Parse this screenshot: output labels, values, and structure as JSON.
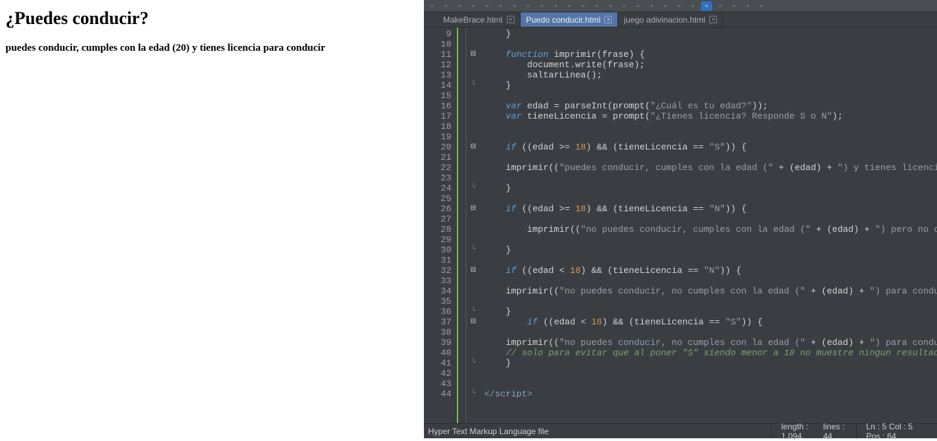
{
  "browser": {
    "heading": "¿Puedes conducir?",
    "paragraph": "puedes conducir, cumples con la edad (20) y tienes licencia para conducir"
  },
  "tabs": [
    {
      "label": "MakeBrace.html",
      "active": false
    },
    {
      "label": "Puedo conducir.html",
      "active": true
    },
    {
      "label": "juego adivinacion.html",
      "active": false
    }
  ],
  "code_lines": [
    {
      "n": 9,
      "fold": "",
      "html": "    <span class='op'>}</span>"
    },
    {
      "n": 10,
      "fold": "",
      "html": ""
    },
    {
      "n": 11,
      "fold": "box",
      "html": "    <span class='kw'>function</span> <span class='fn'>imprimir</span><span class='paren'>(</span>frase<span class='paren'>)</span> <span class='op'>{</span>"
    },
    {
      "n": 12,
      "fold": "",
      "html": "        document<span class='op'>.</span>write<span class='paren'>(</span>frase<span class='paren'>)</span><span class='op'>;</span>"
    },
    {
      "n": 13,
      "fold": "",
      "html": "        saltarLinea<span class='paren'>()</span><span class='op'>;</span>"
    },
    {
      "n": 14,
      "fold": "end",
      "html": "    <span class='op'>}</span>"
    },
    {
      "n": 15,
      "fold": "",
      "html": ""
    },
    {
      "n": 16,
      "fold": "",
      "html": "    <span class='kw'>var</span> edad <span class='op'>=</span> parseInt<span class='paren'>(</span>prompt<span class='paren'>(</span><span class='str'>\"¿Cuál es tu edad?\"</span><span class='paren'>))</span><span class='op'>;</span>"
    },
    {
      "n": 17,
      "fold": "",
      "html": "    <span class='kw'>var</span> tieneLicencia <span class='op'>=</span> prompt<span class='paren'>(</span><span class='str'>\"¿Tienes licencia? Responde S o N\"</span><span class='paren'>)</span><span class='op'>;</span>"
    },
    {
      "n": 18,
      "fold": "",
      "html": ""
    },
    {
      "n": 19,
      "fold": "",
      "html": ""
    },
    {
      "n": 20,
      "fold": "box",
      "html": "    <span class='kw'>if</span> <span class='paren'>((</span>edad <span class='op'>&gt;=</span> <span class='num'>18</span><span class='paren'>)</span> <span class='op'>&amp;&amp;</span> <span class='paren'>(</span>tieneLicencia <span class='op'>==</span> <span class='str'>\"S\"</span><span class='paren'>))</span> <span class='op'>{</span>"
    },
    {
      "n": 21,
      "fold": "",
      "html": ""
    },
    {
      "n": 22,
      "fold": "",
      "html": "    imprimir<span class='paren'>((</span><span class='str'>\"puedes conducir, cumples con la edad (\"</span> <span class='op'>+</span> <span class='paren'>(</span>edad<span class='paren'>)</span> <span class='op'>+</span> <span class='str'>\") y tienes licencia para cond</span>"
    },
    {
      "n": 23,
      "fold": "",
      "html": ""
    },
    {
      "n": 24,
      "fold": "end",
      "html": "    <span class='op'>}</span>"
    },
    {
      "n": 25,
      "fold": "",
      "html": ""
    },
    {
      "n": 26,
      "fold": "box",
      "html": "    <span class='kw'>if</span> <span class='paren'>((</span>edad <span class='op'>&gt;=</span> <span class='num'>18</span><span class='paren'>)</span> <span class='op'>&amp;&amp;</span> <span class='paren'>(</span>tieneLicencia <span class='op'>==</span> <span class='str'>\"N\"</span><span class='paren'>))</span> <span class='op'>{</span>"
    },
    {
      "n": 27,
      "fold": "",
      "html": ""
    },
    {
      "n": 28,
      "fold": "",
      "html": "        imprimir<span class='paren'>((</span><span class='str'>\"no puedes conducir, cumples con la edad (\"</span> <span class='op'>+</span> <span class='paren'>(</span>edad<span class='paren'>)</span> <span class='op'>+</span> <span class='str'>\") pero no cuentas con l</span>"
    },
    {
      "n": 29,
      "fold": "",
      "html": ""
    },
    {
      "n": 30,
      "fold": "end",
      "html": "    <span class='op'>}</span>"
    },
    {
      "n": 31,
      "fold": "",
      "html": ""
    },
    {
      "n": 32,
      "fold": "box",
      "html": "    <span class='kw'>if</span> <span class='paren'>((</span>edad <span class='op'>&lt;</span> <span class='num'>18</span><span class='paren'>)</span> <span class='op'>&amp;&amp;</span> <span class='paren'>(</span>tieneLicencia <span class='op'>==</span> <span class='str'>\"N\"</span><span class='paren'>))</span> <span class='op'>{</span>"
    },
    {
      "n": 33,
      "fold": "",
      "html": ""
    },
    {
      "n": 34,
      "fold": "",
      "html": "    imprimir<span class='paren'>((</span><span class='str'>\"no puedes conducir, no cumples con la edad (\"</span> <span class='op'>+</span> <span class='paren'>(</span>edad<span class='paren'>)</span> <span class='op'>+</span> <span class='str'>\") para conducir\"</span><span class='paren'>))</span>"
    },
    {
      "n": 35,
      "fold": "",
      "html": ""
    },
    {
      "n": 36,
      "fold": "end",
      "html": "    <span class='op'>}</span>"
    },
    {
      "n": 37,
      "fold": "box",
      "html": "        <span class='kw'>if</span> <span class='paren'>((</span>edad <span class='op'>&lt;</span> <span class='num'>18</span><span class='paren'>)</span> <span class='op'>&amp;&amp;</span> <span class='paren'>(</span>tieneLicencia <span class='op'>==</span> <span class='str'>\"S\"</span><span class='paren'>))</span> <span class='op'>{</span>"
    },
    {
      "n": 38,
      "fold": "",
      "html": ""
    },
    {
      "n": 39,
      "fold": "",
      "html": "    imprimir<span class='paren'>((</span><span class='str'>\"no puedes conducir, no cumples con la edad (\"</span> <span class='op'>+</span> <span class='paren'>(</span>edad<span class='paren'>)</span> <span class='op'>+</span> <span class='str'>\") para conducir\"</span><span class='paren'>))</span>"
    },
    {
      "n": 40,
      "fold": "",
      "html": "    <span class='cmt'>// solo para evitar que al poner \"S\" siendo menor a 18 no muestre ningun resultado</span>"
    },
    {
      "n": 41,
      "fold": "end",
      "html": "    <span class='op'>}</span>"
    },
    {
      "n": 42,
      "fold": "",
      "html": ""
    },
    {
      "n": 43,
      "fold": "",
      "html": ""
    },
    {
      "n": 44,
      "fold": "end",
      "html": "<span class='tag'>&lt;/script&gt;</span>"
    }
  ],
  "statusbar": {
    "filetype": "Hyper Text Markup Language file",
    "length_label": "length : 1,094",
    "lines_label": "lines : 44",
    "pos_label": "Ln : 5   Col : 5   Pos : 64"
  },
  "toolbar_icons": [
    "new",
    "open",
    "save",
    "save-all",
    "close",
    "print",
    "cut",
    "copy",
    "paste",
    "undo",
    "redo",
    "find",
    "replace",
    "zoom-in",
    "zoom-out",
    "sync",
    "wrap",
    "show-all",
    "indent",
    "outdent",
    "fold",
    "unfold",
    "macro-rec",
    "macro-play",
    "macro-stop"
  ]
}
